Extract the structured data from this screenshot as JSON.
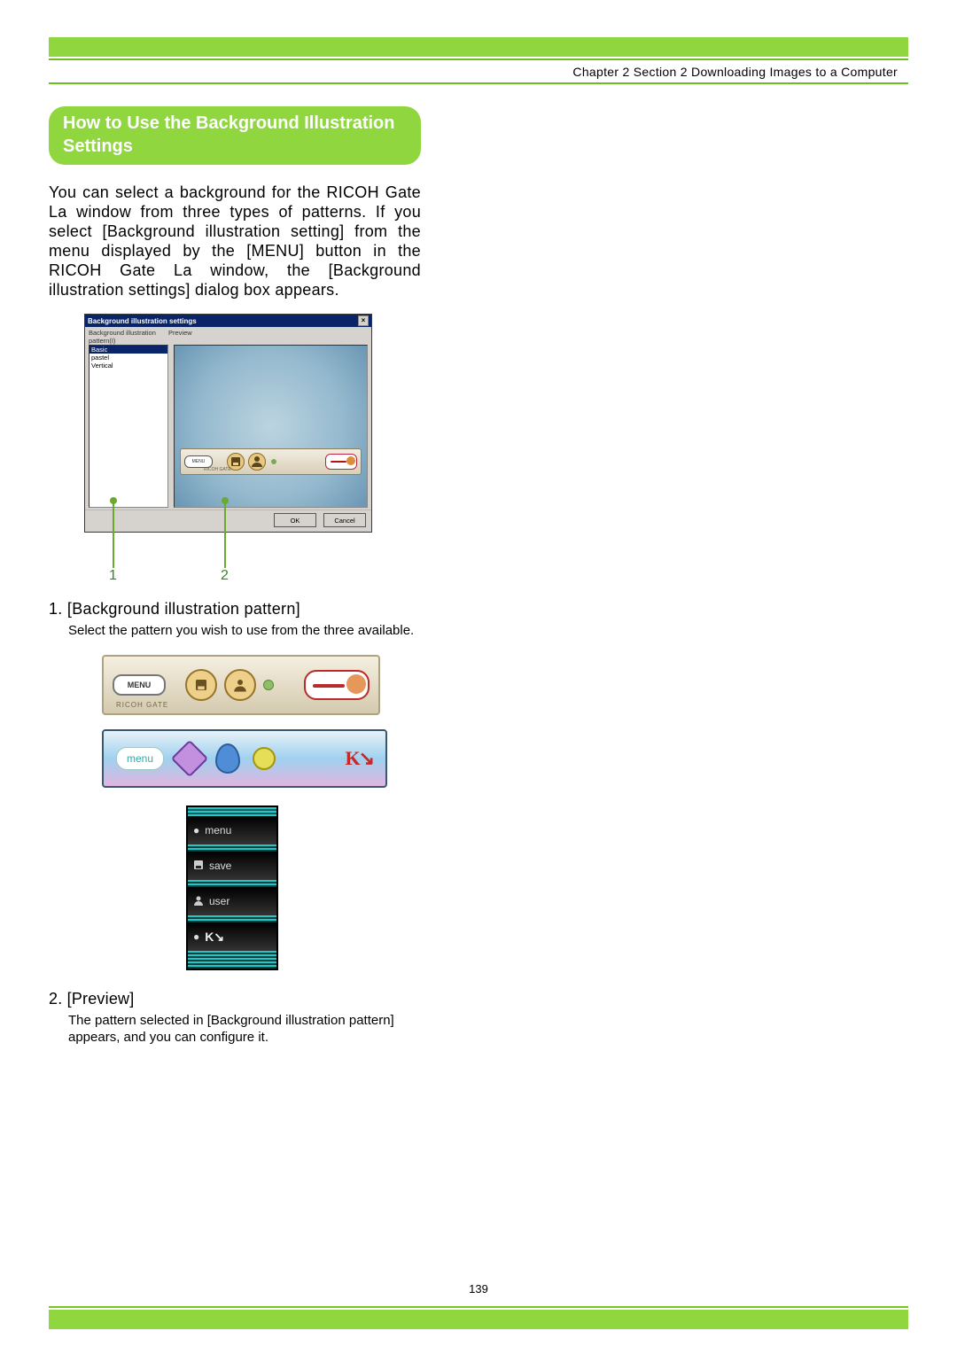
{
  "header": {
    "breadcrumb": "Chapter 2 Section 2 Downloading Images to a Computer"
  },
  "section": {
    "title": "How to Use the Background Illustration Settings",
    "intro": "You can select a background for the RICOH Gate La window from three types of patterns. If you select [Background illustration setting] from the menu displayed by the [MENU] button in the RICOH Gate La window, the [Background illustration settings] dialog box appears."
  },
  "dialog": {
    "title": "Background illustration settings",
    "label_pattern": "Background illustration pattern(I)",
    "label_preview": "Preview",
    "patterns": [
      "Basic",
      "pastel",
      "Vertical"
    ],
    "menu_label": "MENU",
    "ricoh_label": "RICOH GATE",
    "ok": "OK",
    "cancel": "Cancel"
  },
  "callouts": {
    "c1": "1",
    "c2": "2"
  },
  "items": {
    "i1": {
      "head": "1. [Background illustration pattern]",
      "desc": "Select the pattern you wish to use from the three available."
    },
    "i2": {
      "head": "2. [Preview]",
      "desc": "The pattern selected in [Background illustration pattern] appears, and you can configure it."
    }
  },
  "pattern_basic": {
    "menu": "MENU",
    "sub": "RICOH GATE"
  },
  "pattern_pastel": {
    "menu": "menu",
    "logo": "K↓"
  },
  "pattern_vertical": {
    "menu": "menu",
    "save": "save",
    "user": "user"
  },
  "page_number": "139"
}
